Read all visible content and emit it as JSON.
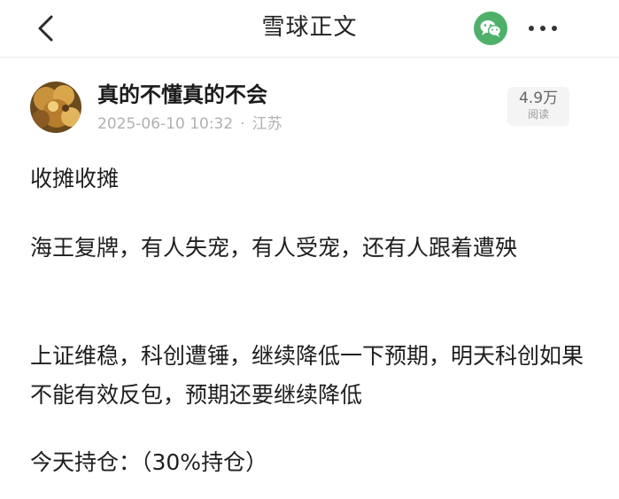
{
  "header": {
    "title": "雪球正文"
  },
  "icons": {
    "back": "chevron-left-icon",
    "share": "wechat-icon",
    "more": "more-horizontal-icon"
  },
  "colors": {
    "wechat_green": "#4fb06a",
    "meta_gray": "#b0b0b0"
  },
  "post": {
    "author": "真的不懂真的不会",
    "date": "2025-06-10 10:32",
    "separator": "·",
    "location": "江苏",
    "views": "4.9万",
    "views_label": "阅读",
    "paragraphs": [
      "收摊收摊",
      "海王复牌，有人失宠，有人受宠，还有人跟着遭殃",
      "上证维稳，科创遭锤，继续降低一下预期，明天科创如果不能有效反包，预期还要继续降低",
      "今天持仓：（30%持仓）"
    ]
  }
}
